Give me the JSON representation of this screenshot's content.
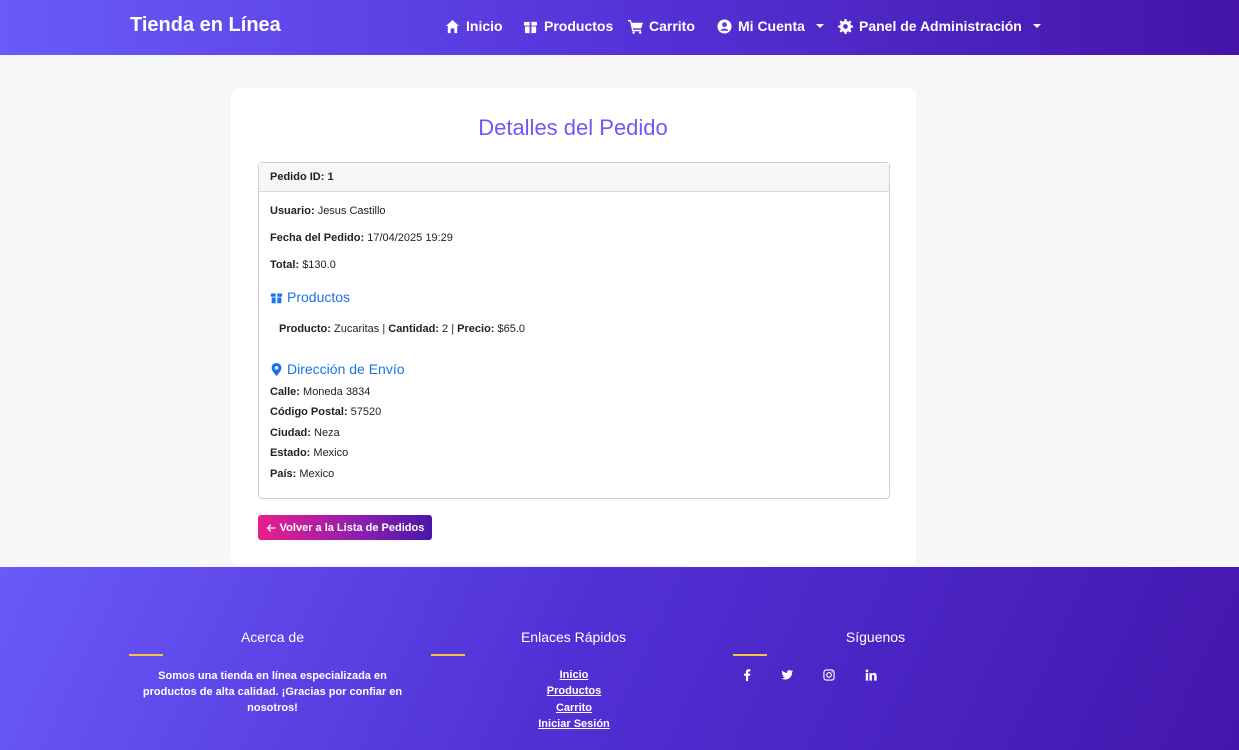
{
  "navbar": {
    "brand": "Tienda en Línea",
    "items": [
      {
        "label": "Inicio",
        "icon": "home-icon"
      },
      {
        "label": "Productos",
        "icon": "box-icon"
      },
      {
        "label": "Carrito",
        "icon": "cart-icon"
      },
      {
        "label": "Mi Cuenta",
        "icon": "user-circle-icon",
        "dropdown": true
      },
      {
        "label": "Panel de Administración",
        "icon": "gear-icon",
        "dropdown": true
      }
    ]
  },
  "order": {
    "page_title": "Detalles del Pedido",
    "header": "Pedido ID: 1",
    "user_label": "Usuario:",
    "user_value": "Jesus Castillo",
    "date_label": "Fecha del Pedido:",
    "date_value": "17/04/2025 19:29",
    "total_label": "Total:",
    "total_value": "$130.0",
    "products_title": "Productos",
    "products": [
      {
        "product_label": "Producto:",
        "product_value": "Zucaritas",
        "sep1": "|",
        "qty_label": "Cantidad:",
        "qty_value": "2",
        "sep2": "|",
        "price_label": "Precio:",
        "price_value": "$65.0"
      }
    ],
    "address_title": "Dirección de Envío",
    "address": [
      {
        "label": "Calle:",
        "value": "Moneda 3834"
      },
      {
        "label": "Código Postal:",
        "value": "57520"
      },
      {
        "label": "Ciudad:",
        "value": "Neza"
      },
      {
        "label": "Estado:",
        "value": "Mexico"
      },
      {
        "label": "País:",
        "value": "Mexico"
      }
    ],
    "back_button": "Volver a la Lista de Pedidos"
  },
  "footer": {
    "about_title": "Acerca de",
    "about_text": "Somos una tienda en línea especializada en productos de alta calidad. ¡Gracias por confiar en nosotros!",
    "links_title": "Enlaces Rápidos",
    "links": [
      "Inicio",
      "Productos",
      "Carrito",
      "Iniciar Sesión"
    ],
    "social_title": "Síguenos",
    "social": [
      "facebook-icon",
      "twitter-icon",
      "instagram-icon",
      "linkedin-icon"
    ]
  },
  "colors": {
    "accent": "#6a5af9",
    "link_blue": "#1a73e8",
    "footer_bar": "#f6c445"
  }
}
